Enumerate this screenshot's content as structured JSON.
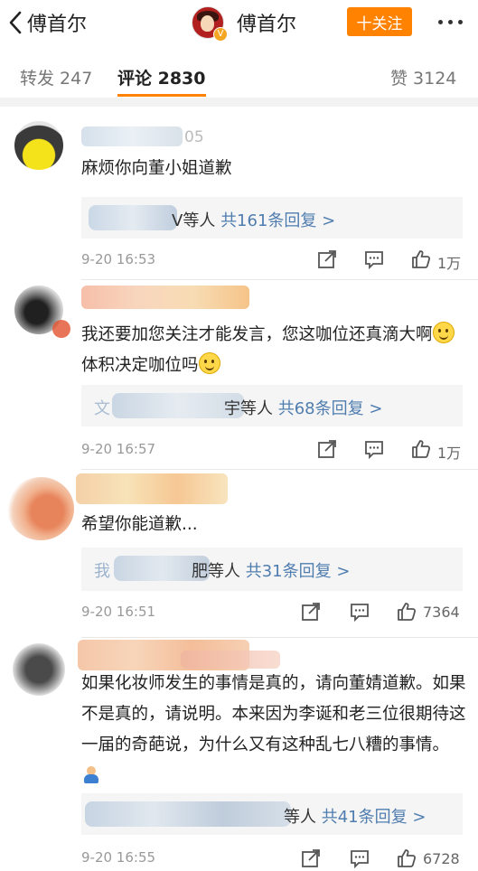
{
  "header": {
    "back_label": "傅首尔",
    "title": "傅首尔",
    "verified_badge": "V",
    "follow_label": "十关注"
  },
  "tabs": [
    {
      "label": "转发 247"
    },
    {
      "label": "评论 2830"
    },
    {
      "label": "赞 3124"
    }
  ],
  "colors": {
    "accent": "#ff8200",
    "link": "#507daf"
  },
  "comments": [
    {
      "name_tail": "05",
      "text": "麻烦你向董小姐道歉",
      "reply_suffix": "V等人",
      "reply_link": "共161条回复 >",
      "time": "9-20 16:53",
      "likes": "1万"
    },
    {
      "text_part1": "我还要加您关注才能发言，您这咖位还真滴大啊",
      "text_part2": "体积决定咖位吗",
      "reply_prefix": "文",
      "reply_suffix": "宇等人",
      "reply_link": "共68条回复 >",
      "time": "9-20 16:57",
      "likes": "1万"
    },
    {
      "text": "希望你能道歉...",
      "reply_prefix": "我",
      "reply_suffix": "肥等人",
      "reply_link": "共31条回复 >",
      "time": "9-20 16:51",
      "likes": "7364"
    },
    {
      "text": "如果化妆师发生的事情是真的，请向董婧道歉。如果不是真的，请说明。本来因为李诞和老三位很期待这一届的奇葩说，为什么又有这种乱七八糟的事情。",
      "reply_suffix": "等人",
      "reply_link": "共41条回复 >",
      "time": "9-20 16:55",
      "likes": "6728"
    }
  ]
}
